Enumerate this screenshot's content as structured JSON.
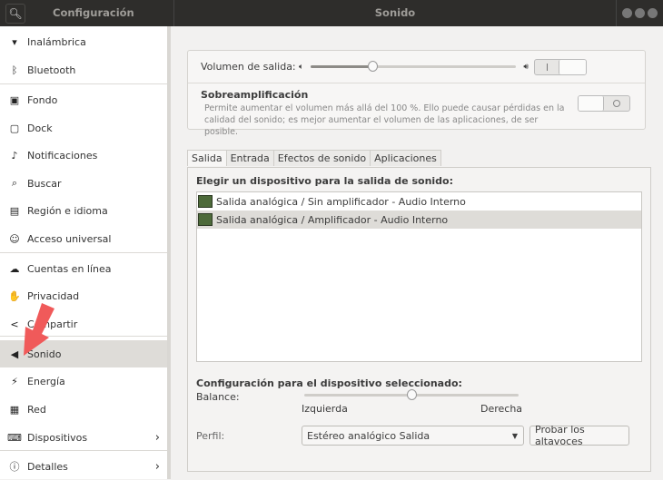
{
  "titlebar": {
    "left_title": "Configuración",
    "title": "Sonido"
  },
  "sidebar": {
    "items": [
      {
        "label": "Inalámbrica",
        "icon": "wifi-icon"
      },
      {
        "label": "Bluetooth",
        "icon": "bluetooth-icon"
      },
      {
        "label": "Fondo",
        "icon": "background-icon"
      },
      {
        "label": "Dock",
        "icon": "dock-icon"
      },
      {
        "label": "Notificaciones",
        "icon": "bell-icon"
      },
      {
        "label": "Buscar",
        "icon": "search-icon"
      },
      {
        "label": "Región e idioma",
        "icon": "region-icon"
      },
      {
        "label": "Acceso universal",
        "icon": "accessibility-icon"
      },
      {
        "label": "Cuentas en línea",
        "icon": "online-accounts-icon"
      },
      {
        "label": "Privacidad",
        "icon": "privacy-hand-icon"
      },
      {
        "label": "Compartir",
        "icon": "share-icon"
      },
      {
        "label": "Sonido",
        "icon": "speaker-icon",
        "selected": true
      },
      {
        "label": "Energía",
        "icon": "power-icon"
      },
      {
        "label": "Red",
        "icon": "network-icon"
      },
      {
        "label": "Dispositivos",
        "icon": "devices-icon",
        "chevron": true
      },
      {
        "label": "Detalles",
        "icon": "details-icon",
        "chevron": true
      }
    ]
  },
  "output_volume": {
    "label": "Volumen de salida:",
    "level_percent": 30,
    "mute_switch": "on"
  },
  "overamplification": {
    "title": "Sobreamplificación",
    "description": "Permite aumentar el volumen más allá del 100 %. Ello puede causar pérdidas en la calidad del sonido; es mejor aumentar el volumen de las aplicaciones, de ser posible.",
    "enabled": false
  },
  "tabs": [
    "Salida",
    "Entrada",
    "Efectos de sonido",
    "Aplicaciones"
  ],
  "output": {
    "heading": "Elegir un dispositivo para la salida de sonido:",
    "devices": [
      {
        "label": "Salida analógica / Sin amplificador - Audio Interno",
        "selected": false
      },
      {
        "label": "Salida analógica / Amplificador - Audio Interno",
        "selected": true
      }
    ]
  },
  "device_config": {
    "heading": "Configuración para el dispositivo seleccionado:",
    "balance_label": "Balance:",
    "balance_left": "Izquierda",
    "balance_right": "Derecha",
    "balance_value": 0.5,
    "profile_label": "Perfil:",
    "profile_value": "Estéreo analógico Salida",
    "test_button": "Probar los altavoces"
  },
  "colors": {
    "titlebar": "#2e2d2b",
    "selected": "#dedcd8",
    "arrow": "#f05a5a"
  }
}
